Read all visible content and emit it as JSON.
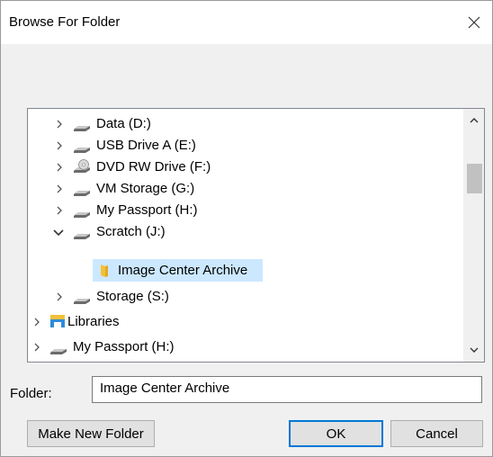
{
  "window": {
    "title": "Browse For Folder",
    "close_icon": "close-icon"
  },
  "tree": {
    "items": [
      {
        "label": "Data (D:)",
        "icon": "drive-icon",
        "expanded": false
      },
      {
        "label": "USB Drive A (E:)",
        "icon": "drive-icon",
        "expanded": false
      },
      {
        "label": "DVD RW Drive (F:)",
        "icon": "dvd-drive-icon",
        "expanded": false
      },
      {
        "label": "VM Storage (G:)",
        "icon": "drive-icon",
        "expanded": false
      },
      {
        "label": "My Passport (H:)",
        "icon": "drive-icon",
        "expanded": false
      },
      {
        "label": "Scratch (J:)",
        "icon": "drive-icon",
        "expanded": true
      },
      {
        "label": "Image Center Archive",
        "icon": "folder-icon",
        "selected": true
      },
      {
        "label": "Storage (S:)",
        "icon": "drive-icon",
        "expanded": false
      },
      {
        "label": "Libraries",
        "icon": "libraries-icon",
        "expanded": false
      },
      {
        "label": "My Passport (H:)",
        "icon": "drive-icon",
        "expanded": false
      }
    ],
    "selection_color": "#cce8ff"
  },
  "folder": {
    "label": "Folder:",
    "value": "Image Center Archive"
  },
  "buttons": {
    "make_new_folder": "Make New Folder",
    "ok": "OK",
    "cancel": "Cancel"
  },
  "colors": {
    "accent": "#0078d7",
    "folder": "#f3c13a"
  }
}
